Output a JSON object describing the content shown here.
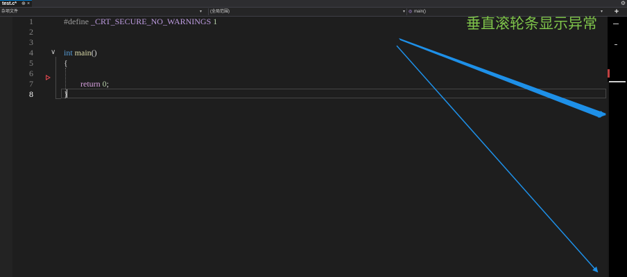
{
  "tab": {
    "title": "test.c*",
    "pin_icon": "pin-icon",
    "close_icon": "close-icon",
    "pin_glyph": "⊕",
    "close_glyph": "×"
  },
  "toolbar": {
    "gear_glyph": "⚙",
    "split_glyph": "+"
  },
  "nav": {
    "project": "杂项文件",
    "scope": "(全局范围)",
    "function": "main()",
    "dropdown_glyph": "▾"
  },
  "editor": {
    "line_numbers": [
      "1",
      "2",
      "3",
      "4",
      "5",
      "6",
      "7",
      "8"
    ],
    "active_line": "8",
    "fold_glyph": "∨",
    "lines": {
      "l1_directive": "#define",
      "l1_macro": " _CRT_SECURE_NO_WARNINGS",
      "l1_value": " 1",
      "l4_type": "int",
      "l4_name": " main",
      "l4_parens": "()",
      "l5_brace": "{",
      "l7_return": "return",
      "l7_value": " 0",
      "l7_semicolon": ";",
      "l8_brace": "}"
    }
  },
  "annotation": {
    "text": "垂直滚轮条显示异常"
  },
  "colors": {
    "arrow": "#1e90e8",
    "annotation": "#7ec34a",
    "keyword": "#569cd6"
  }
}
